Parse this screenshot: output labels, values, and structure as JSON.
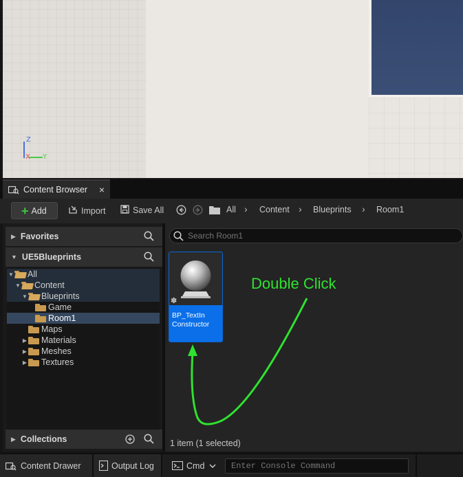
{
  "viewport": {
    "axis_labels": {
      "z": "Z",
      "x": "X",
      "y": "Y"
    }
  },
  "tab": {
    "title": "Content Browser",
    "close": "×"
  },
  "toolbar": {
    "add_label": "Add",
    "import_label": "Import",
    "save_all_label": "Save All",
    "breadcrumbs": [
      "All",
      "Content",
      "Blueprints",
      "Room1"
    ]
  },
  "sidebar": {
    "favorites_label": "Favorites",
    "project_label": "UE5Blueprints",
    "collections_label": "Collections",
    "tree": [
      {
        "label": "All"
      },
      {
        "label": "Content"
      },
      {
        "label": "Blueprints"
      },
      {
        "label": "Game"
      },
      {
        "label": "Room1"
      },
      {
        "label": "Maps"
      },
      {
        "label": "Materials"
      },
      {
        "label": "Meshes"
      },
      {
        "label": "Textures"
      }
    ]
  },
  "content": {
    "search_placeholder": "Search Room1",
    "asset_label_line1": "BP_TextIn",
    "asset_label_line2": "Constructor",
    "annotation": "Double Click",
    "status": "1 item (1 selected)"
  },
  "bottom": {
    "content_drawer_label": "Content Drawer",
    "output_log_label": "Output Log",
    "cmd_label": "Cmd",
    "console_placeholder": "Enter Console Command"
  },
  "colors": {
    "accent": "#0a6fe8",
    "annotation": "#2fe22f",
    "folder": "#c89a50"
  }
}
